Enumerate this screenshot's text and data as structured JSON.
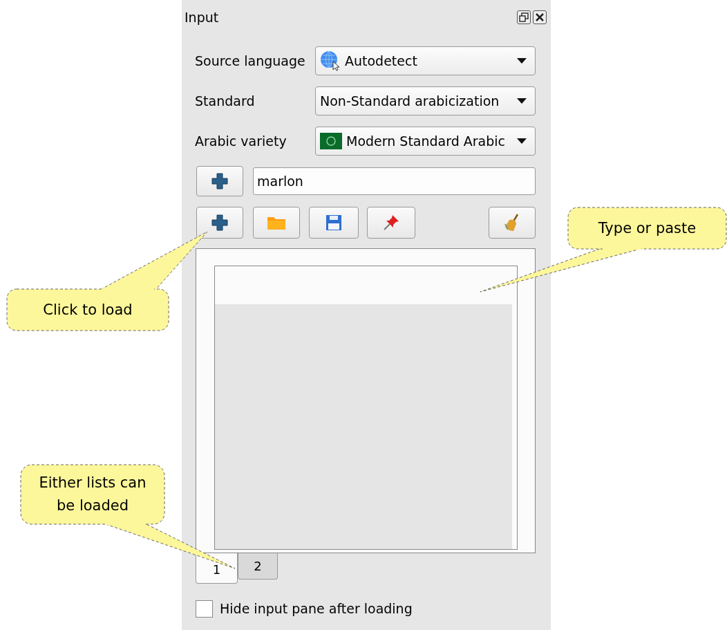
{
  "panel": {
    "title": "Input"
  },
  "fields": [
    {
      "label": "Source language",
      "value": "Autodetect",
      "kind": "globe"
    },
    {
      "label": "Standard",
      "value": "Non-Standard arabicization",
      "kind": "plain"
    },
    {
      "label": "Arabic variety",
      "value": "Modern Standard Arabic",
      "kind": "flag"
    }
  ],
  "word_input": {
    "value": "marlon"
  },
  "tabs": [
    {
      "label": "1",
      "selected": true
    },
    {
      "label": "2",
      "selected": false
    }
  ],
  "hide_pane": {
    "label": "Hide input pane after loading",
    "checked": false
  },
  "callouts": [
    {
      "text": "Click to load"
    },
    {
      "text": "Type or paste"
    },
    {
      "text": "Either lists can be loaded"
    }
  ]
}
